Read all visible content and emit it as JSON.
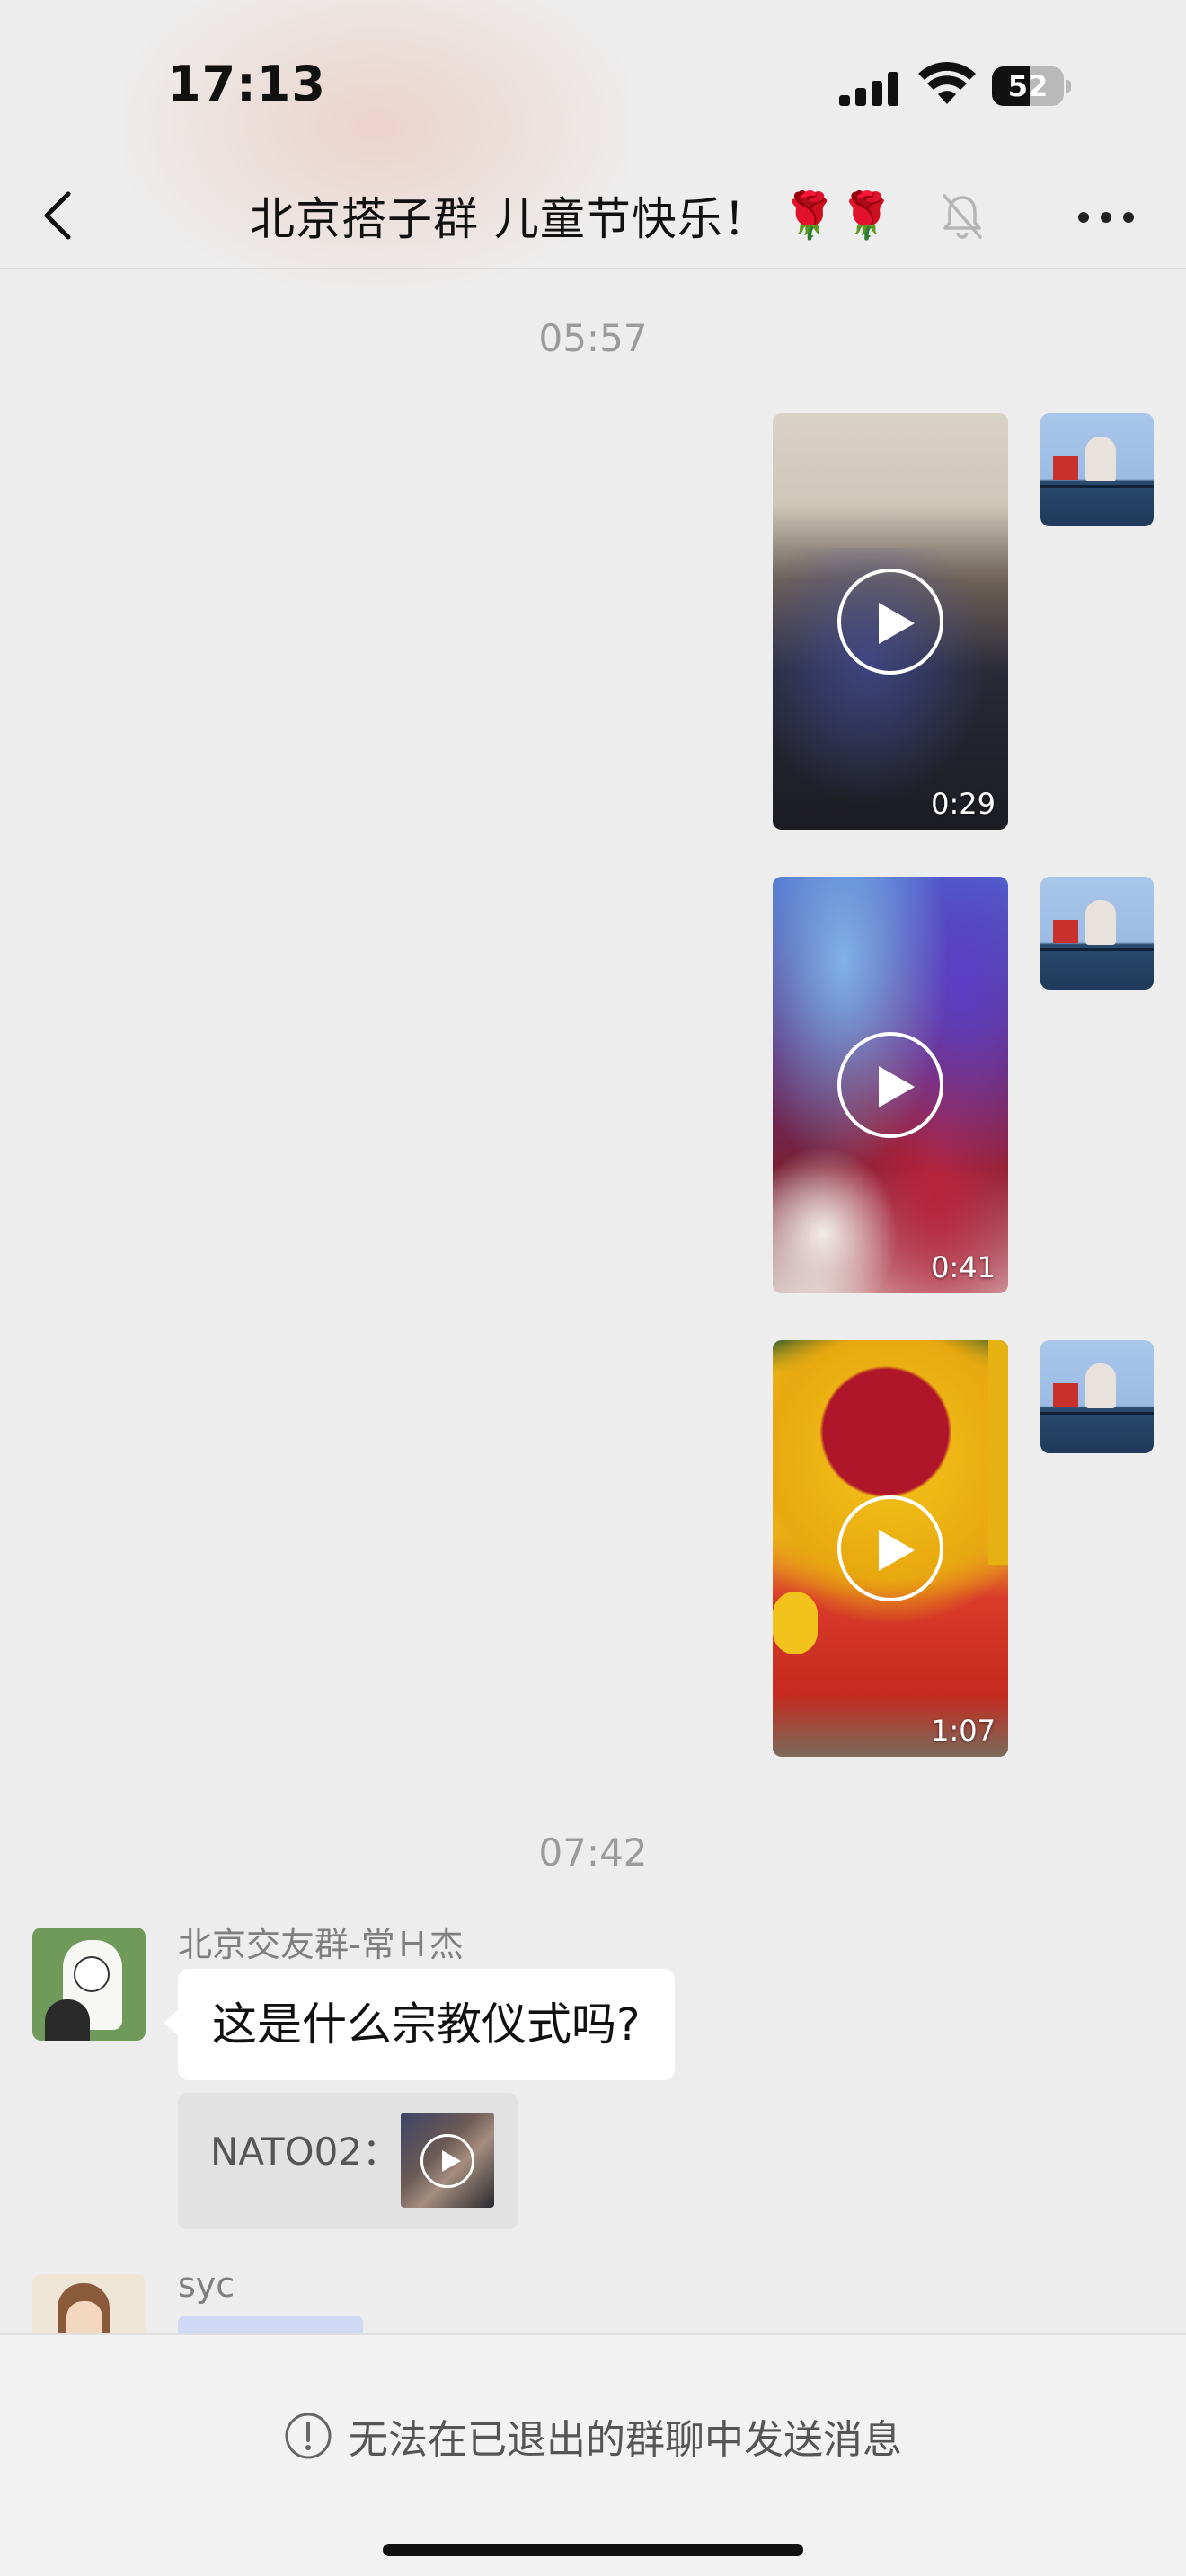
{
  "status_bar": {
    "time": "17:13",
    "battery": "52",
    "battery_level": 0.52
  },
  "nav": {
    "title": "北京搭子群 儿童节快乐！",
    "title_emoji": "🌹🌹"
  },
  "messages": {
    "timestamp_1": "05:57",
    "video_1_duration": "0:29",
    "video_2_duration": "0:41",
    "video_3_duration": "1:07",
    "timestamp_2": "07:42",
    "msg_1": {
      "sender": "北京交友群-常Ｈ杰",
      "text": "这是什么宗教仪式吗?",
      "quote_text": "NATO02："
    },
    "msg_2": {
      "sender": "syc"
    }
  },
  "footer": {
    "notice": "无法在已退出的群聊中发送消息"
  }
}
